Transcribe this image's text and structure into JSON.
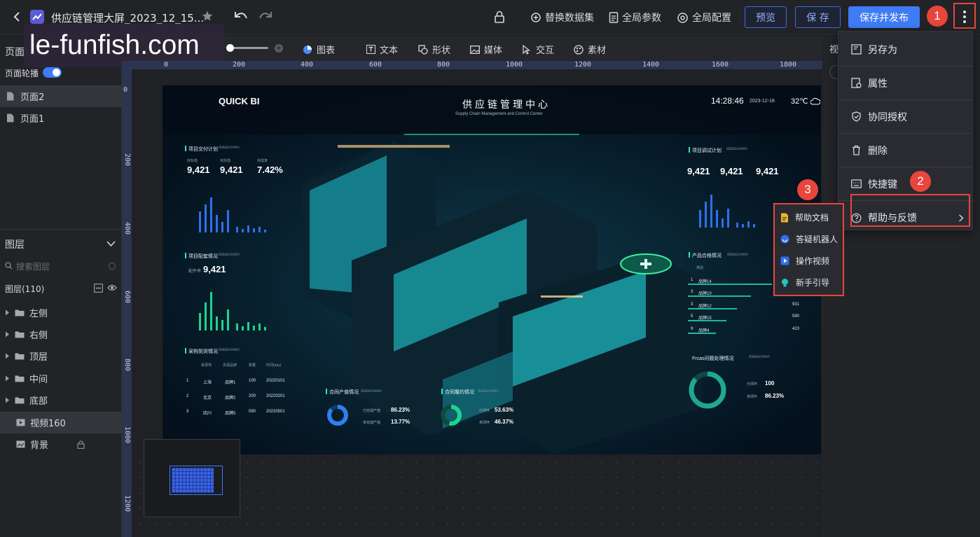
{
  "topbar": {
    "title": "供应链管理大屏_2023_12_15...",
    "actions": [
      "替换数据集",
      "全局参数",
      "全局配置"
    ],
    "preview": "预览",
    "save": "保 存",
    "save_publish": "保存并发布"
  },
  "watermark": "le-funfish.com",
  "toolbar": {
    "tools": [
      "图表",
      "文本",
      "形状",
      "媒体",
      "交互",
      "素材"
    ]
  },
  "left_panel": {
    "page_label": "页面",
    "carousel_label": "页面轮播",
    "pages": [
      "页面2",
      "页面1"
    ],
    "layers_title": "图层",
    "search_placeholder": "搜索图层",
    "layers_count": "图层(110)",
    "groups": [
      "左侧",
      "右侧",
      "顶层",
      "中间",
      "底部"
    ],
    "video_item": "视频160",
    "background_item": "背景"
  },
  "rulers": {
    "h_labels": [
      "0",
      "200",
      "400",
      "600",
      "800",
      "1000",
      "1200",
      "1400",
      "1600",
      "1800"
    ],
    "v_labels": [
      "0",
      "200",
      "400",
      "600",
      "800",
      "1000",
      "1200"
    ]
  },
  "dashboard": {
    "brand": "QUICK BI",
    "title": "供应链管理中心",
    "subtitle": "Supply Chain Management and Control Center",
    "time": "14:28:46",
    "date": "2023-12-18",
    "temp": "32℃",
    "left_top": {
      "title": "项目交付计划",
      "tag": "datascreen",
      "labels": [
        "目标值",
        "实际值",
        "完成率"
      ],
      "values": [
        "9,421",
        "9,421",
        "7.42%"
      ]
    },
    "left_mid": {
      "title": "项目配套情况",
      "tag": "datascreen",
      "label": "配件率",
      "value": "9,421"
    },
    "left_bottom": {
      "title": "采购到货情况",
      "tag": "datascreen",
      "headers": [
        "来源地",
        "货源品牌",
        "数量",
        "时间(day)"
      ],
      "rows": [
        [
          "1",
          "上海",
          "品牌1",
          "100",
          "20220101"
        ],
        [
          "2",
          "北京",
          "品牌2",
          "200",
          "20220201"
        ],
        [
          "3",
          "四川",
          "品牌5",
          "590",
          "20220501"
        ]
      ]
    },
    "right_top": {
      "title": "项目调试计划",
      "tag": "datascreen",
      "values": [
        "9,421",
        "9,421",
        "9,421"
      ]
    },
    "right_mid": {
      "title": "产品合格情况",
      "tag": "datascreen",
      "col": "类别",
      "rows": [
        [
          "1",
          "品牌14",
          ""
        ],
        [
          "3",
          "品牌10",
          ""
        ],
        [
          "3",
          "品牌12",
          "931"
        ],
        [
          "5",
          "品牌15",
          "590"
        ],
        [
          "9",
          "品牌4",
          "423"
        ]
      ]
    },
    "right_bottom": {
      "title": "Frcas问题处理情况",
      "tag": "datascreen",
      "labels": [
        "已闭环",
        "未闭环"
      ],
      "values": [
        "100",
        "86.23%"
      ]
    },
    "bottom_a": {
      "title": "合同产值情况",
      "tag": "datascreen",
      "labels": [
        "已完成产值",
        "未完成产值"
      ],
      "values": [
        "86.23%",
        "13.77%"
      ]
    },
    "bottom_b": {
      "title": "合同履约情况",
      "tag": "datascreen",
      "labels": [
        "已闭环",
        "未闭环"
      ],
      "values": [
        "53.63%",
        "46.37%"
      ]
    }
  },
  "menu": {
    "items": [
      "另存为",
      "属性",
      "协同授权",
      "删除",
      "快捷键",
      "帮助与反馈"
    ]
  },
  "submenu": {
    "items": [
      "帮助文档",
      "答疑机器人",
      "操作视频",
      "新手引导"
    ]
  },
  "badges": [
    "1",
    "2",
    "3"
  ],
  "right_panel": {
    "tab": "视"
  },
  "colors": {
    "accent": "#3e7bf5",
    "highlight": "#e8453c",
    "neon": "#27e6e6"
  }
}
